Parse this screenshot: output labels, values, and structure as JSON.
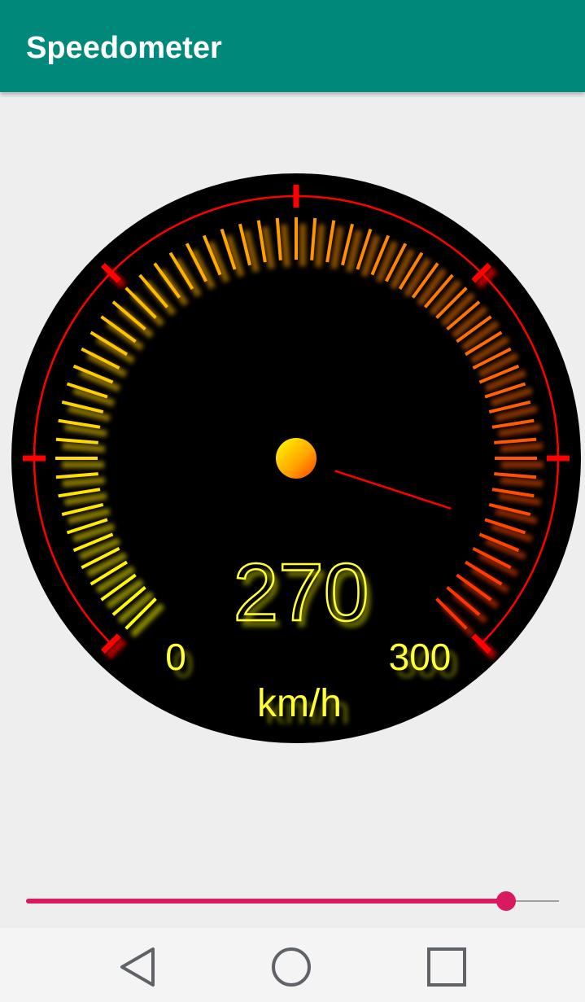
{
  "app_bar": {
    "title": "Speedometer",
    "color": "#00897b"
  },
  "speedometer": {
    "speed": 270,
    "min": 0,
    "max": 300,
    "min_label": "0",
    "max_label": "300",
    "speed_label": "270",
    "unit": "km/h",
    "colors": {
      "dial": "#000000",
      "text": "#ffff33",
      "needle": "#ff0000",
      "ring": "#ff0000",
      "tick_low": "#ffff00",
      "tick_high": "#ff3300"
    }
  },
  "slider": {
    "value": 0.9,
    "accent": "#d81b60"
  },
  "nav": {
    "back": "back-icon",
    "home": "home-icon",
    "recents": "recents-icon"
  }
}
